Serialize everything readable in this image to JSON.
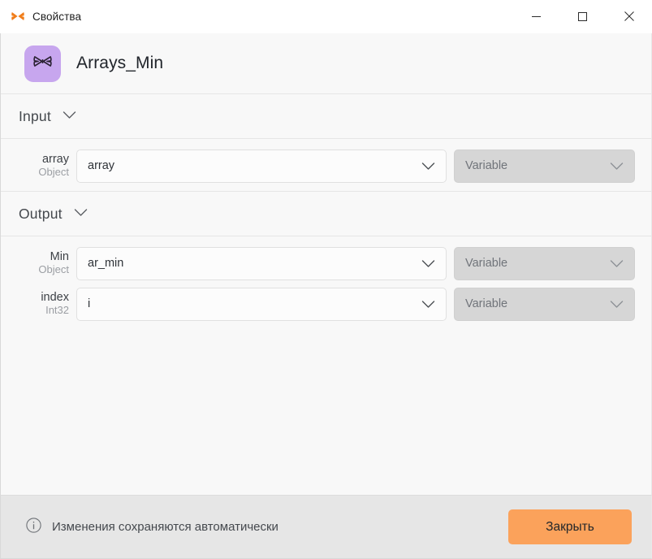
{
  "window": {
    "title": "Свойства",
    "icon": "butterfly-icon",
    "controls": {
      "minimize": "minimize-icon",
      "maximize": "maximize-icon",
      "close": "close-icon"
    }
  },
  "header": {
    "app_name": "Arrays_Min",
    "app_icon": "butterfly-icon",
    "app_icon_bg": "#c7a6ee"
  },
  "sections": [
    {
      "id": "input",
      "title": "Input",
      "chevron": "chevron-down-icon",
      "fields": [
        {
          "label": "array",
          "type": "Object",
          "value": "array",
          "value_chevron": "chevron-down-icon",
          "mode": "Variable",
          "mode_chevron": "chevron-down-icon",
          "mode_disabled": true
        }
      ]
    },
    {
      "id": "output",
      "title": "Output",
      "chevron": "chevron-down-icon",
      "fields": [
        {
          "label": "Min",
          "type": "Object",
          "value": "ar_min",
          "value_chevron": "chevron-down-icon",
          "mode": "Variable",
          "mode_chevron": "chevron-down-icon",
          "mode_disabled": true
        },
        {
          "label": "index",
          "type": "Int32",
          "value": "i",
          "value_chevron": "chevron-down-icon",
          "mode": "Variable",
          "mode_chevron": "chevron-down-icon",
          "mode_disabled": true
        }
      ]
    }
  ],
  "footer": {
    "info_icon": "info-circle-icon",
    "note": "Изменения сохраняются автоматически",
    "close_label": "Закрыть",
    "close_color": "#fba25b"
  }
}
